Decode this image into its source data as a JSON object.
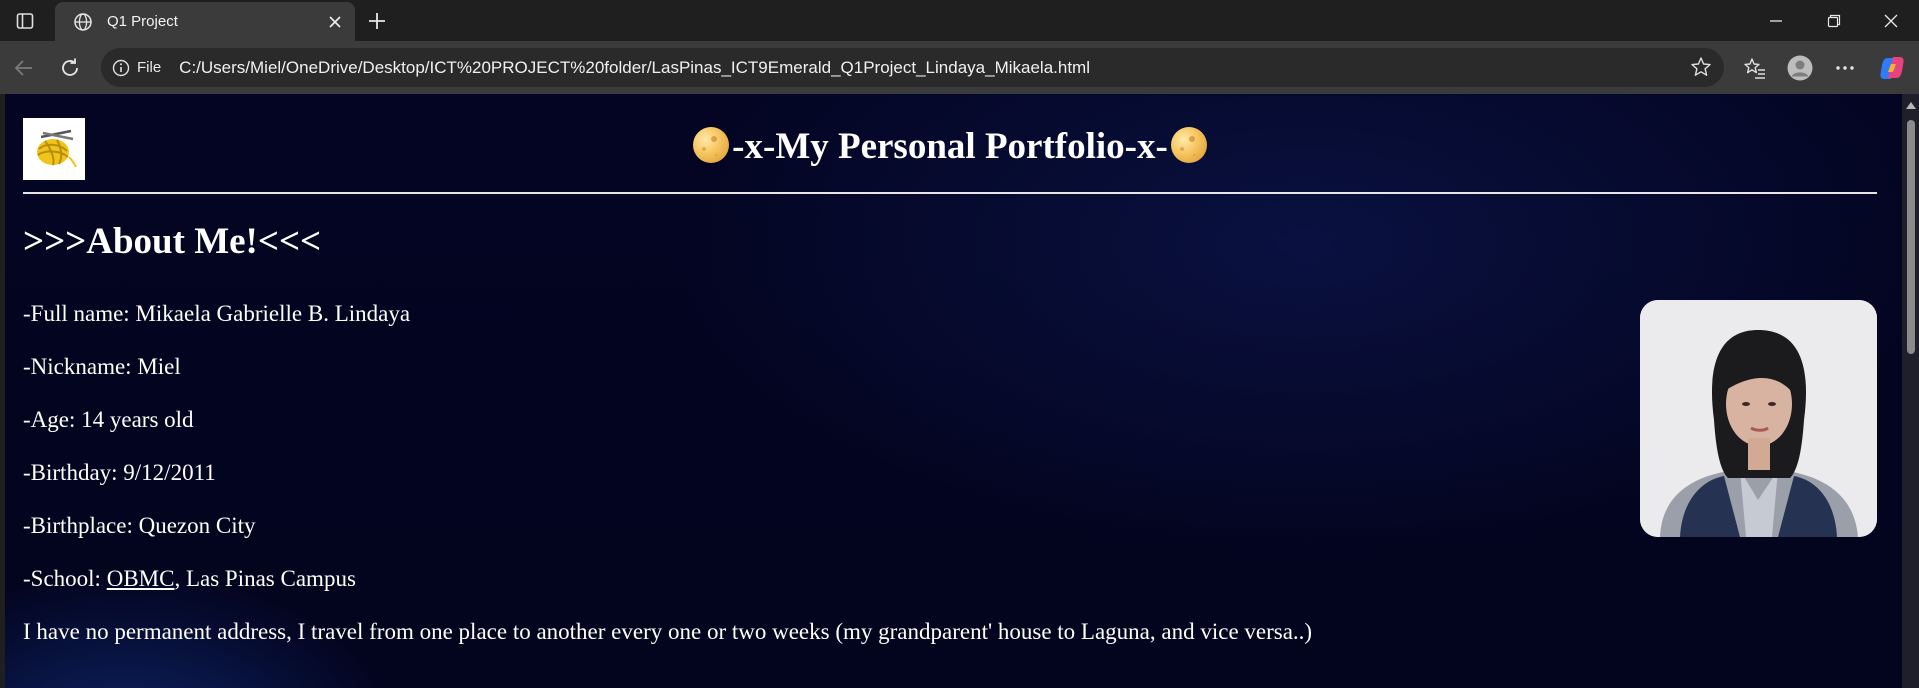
{
  "browser": {
    "tab_title": "Q1 Project",
    "file_label": "File",
    "url": "C:/Users/Miel/OneDrive/Desktop/ICT%20PROJECT%20folder/LasPinas_ICT9Emerald_Q1Project_Lindaya_Mikaela.html"
  },
  "page": {
    "title": "-x-My Personal Portfolio-x-",
    "section_heading": ">>>About Me!<<<",
    "full_name_label": "-Full name:",
    "full_name": "Mikaela Gabrielle B. Lindaya",
    "nickname_label": "-Nickname:",
    "nickname": "Miel",
    "age_label": "-Age:",
    "age": "14 years old",
    "birthday_label": "-Birthday:",
    "birthday": "9/12/2011",
    "birthplace_label": "-Birthplace:",
    "birthplace": "Quezon City",
    "school_label": "-School:",
    "school_link": "OBMC",
    "school_rest": ", Las Pinas Campus",
    "address_note": "I have no permanent address, I travel from one place to another every one or two weeks (my grandparent' house to Laguna, and vice versa..)"
  },
  "colors": {
    "page_background": "#03041d",
    "text": "#ffffff",
    "moon": "#f5c45e"
  }
}
